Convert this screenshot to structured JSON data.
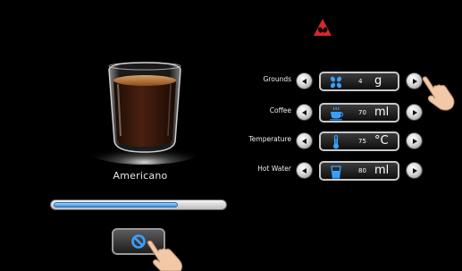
{
  "brand": {
    "icon": "coffee-logo-icon",
    "color": "#d9262c"
  },
  "drink": {
    "name": "Americano",
    "image": "espresso-glass"
  },
  "progress": {
    "fraction": 0.73,
    "color": "#3a8fd8"
  },
  "cancel": {
    "icon": "cancel-icon"
  },
  "settings": [
    {
      "label": "Grounds",
      "icon": "coffee-beans-icon",
      "value": "4",
      "unit": "g"
    },
    {
      "label": "Coffee",
      "icon": "coffee-cup-icon",
      "value": "70",
      "unit": "ml"
    },
    {
      "label": "Temperature",
      "icon": "thermometer-icon",
      "value": "75",
      "unit": "°C"
    },
    {
      "label": "Hot Water",
      "icon": "water-glass-icon",
      "value": "80",
      "unit": "ml"
    }
  ],
  "colors": {
    "background": "#000000",
    "icon_blue": "#3aa0ff",
    "frame": "#c9c9c9"
  }
}
